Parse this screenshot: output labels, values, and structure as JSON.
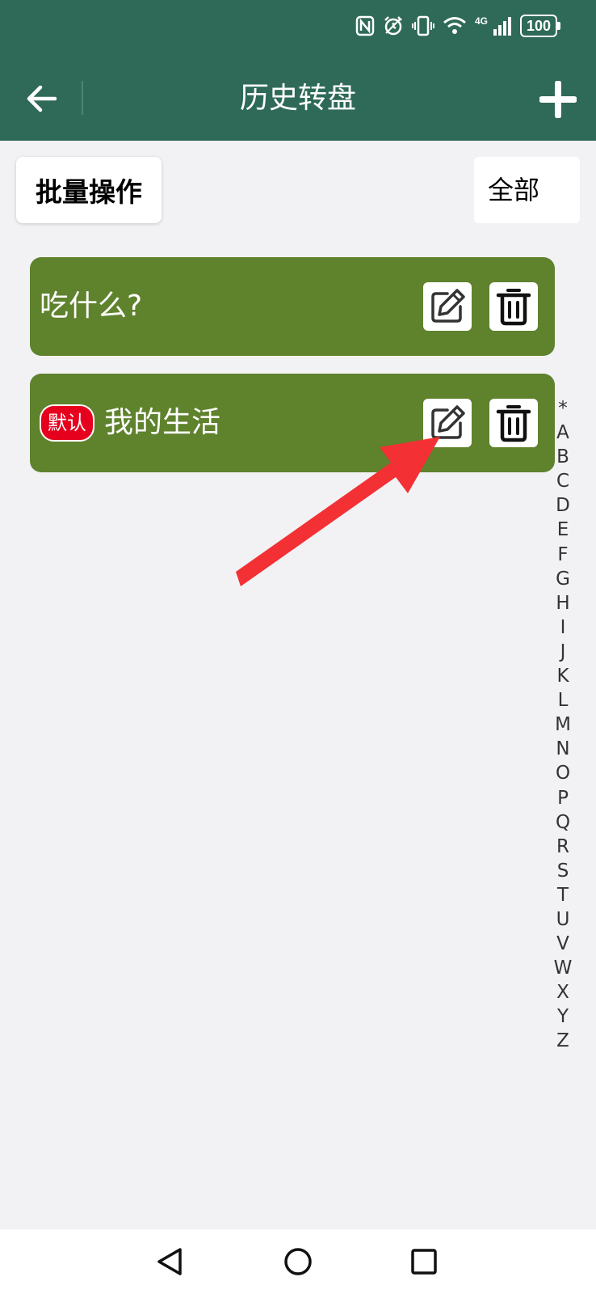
{
  "status_bar": {
    "network": "4G",
    "battery": "100",
    "icons": [
      "nfc-icon",
      "alarm-icon",
      "vibrate-icon",
      "wifi-icon",
      "signal-icon",
      "battery-icon"
    ]
  },
  "header": {
    "title": "历史转盘",
    "back_icon": "arrow-left-icon",
    "add_icon": "plus-icon",
    "background_color": "#2e6a57"
  },
  "toolbar": {
    "batch_label": "批量操作",
    "filter_value": "全部"
  },
  "wheels": [
    {
      "name": "吃什么?",
      "is_default": false
    },
    {
      "name": "我的生活",
      "is_default": true,
      "badge": "默认"
    }
  ],
  "item_color": "#5f822d",
  "badge_color": "#e6001e",
  "annotation_color": "#f33034",
  "alpha_index": [
    "*",
    "A",
    "B",
    "C",
    "D",
    "E",
    "F",
    "G",
    "H",
    "I",
    "J",
    "K",
    "L",
    "M",
    "N",
    "O",
    "P",
    "Q",
    "R",
    "S",
    "T",
    "U",
    "V",
    "W",
    "X",
    "Y",
    "Z"
  ],
  "nav": {
    "icons": [
      "nav-back-icon",
      "nav-home-icon",
      "nav-recent-icon"
    ]
  }
}
